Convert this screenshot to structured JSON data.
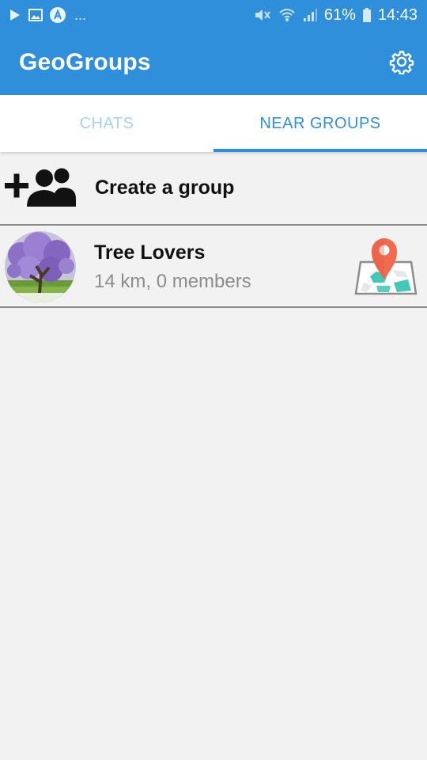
{
  "status_bar": {
    "battery": "61%",
    "time": "14:43",
    "ellipsis": "..."
  },
  "app_bar": {
    "title": "GeoGroups"
  },
  "tabs": [
    {
      "label": "CHATS",
      "selected": false
    },
    {
      "label": "NEAR GROUPS",
      "selected": true
    }
  ],
  "create_group": {
    "label": "Create a group"
  },
  "groups": [
    {
      "name": "Tree Lovers",
      "meta": "14 km, 0 members"
    }
  ],
  "colors": {
    "primary": "#2f8fdb",
    "tab_inactive": "#a8d2f0",
    "background": "#f2f2f2",
    "pin": "#f26b4f"
  },
  "icons": {
    "status_left": [
      "play-store-icon",
      "image-icon",
      "app-a-icon"
    ],
    "status_right": [
      "mute-icon",
      "wifi-icon",
      "signal-icon",
      "battery-icon"
    ],
    "settings": "gear-icon",
    "create_group": "add-group-icon",
    "map": "map-pin-icon"
  }
}
